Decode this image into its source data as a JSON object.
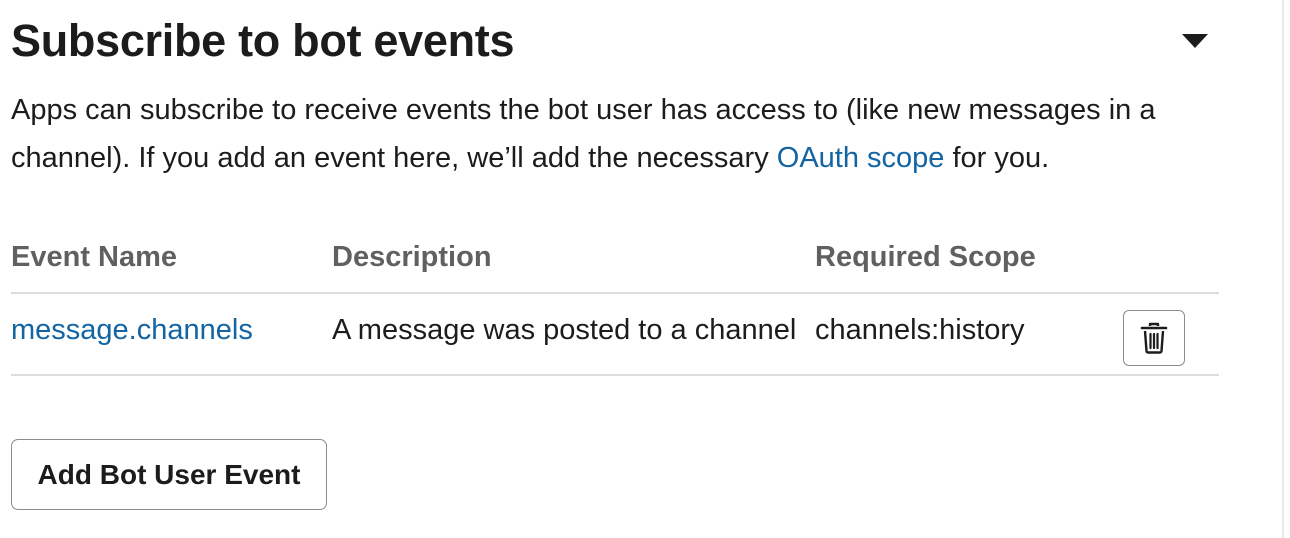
{
  "section": {
    "title": "Subscribe to bot events",
    "collapse_icon": "caret-down-icon",
    "description": {
      "text_before_link": "Apps can subscribe to receive events the bot user has access to (like new messages in a channel). If you add an event here, we’ll add the necessary ",
      "link_text": "OAuth scope",
      "text_after_link": " for you."
    }
  },
  "table": {
    "headers": {
      "event_name": "Event Name",
      "description": "Description",
      "required_scope": "Required Scope"
    },
    "rows": [
      {
        "event_name": "message.channels",
        "description": "A message was posted to a channel",
        "required_scope": "channels:history",
        "delete_icon": "trash-icon"
      }
    ]
  },
  "actions": {
    "add_label": "Add Bot User Event"
  },
  "colors": {
    "link": "#1264a3",
    "text": "#1d1c1d",
    "header_text": "#616061",
    "divider": "#dddddd",
    "button_border": "#8d8d8d"
  }
}
